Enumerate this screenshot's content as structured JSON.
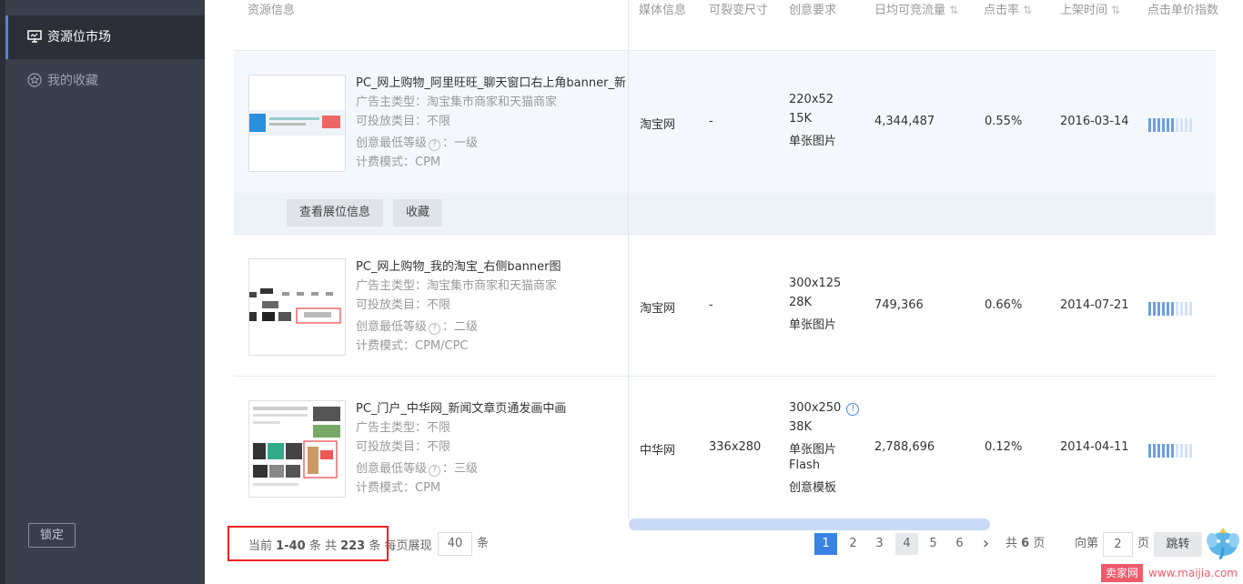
{
  "sidebar": {
    "items": [
      {
        "label": "资源位市场",
        "icon": "monitor-icon"
      },
      {
        "label": "我的收藏",
        "icon": "star-icon"
      }
    ],
    "lock_label": "锁定"
  },
  "table": {
    "headers": {
      "resource": "资源信息",
      "media": "媒体信息",
      "resizable": "可裂变尺寸",
      "creative": "创意要求",
      "traffic": "日均可竞流量",
      "ctr": "点击率",
      "date": "上架时间",
      "cpc_index": "点击单价指数"
    },
    "sort_glyph": "⇅",
    "rows": [
      {
        "title": "PC_网上购物_阿里旺旺_聊天窗口右上角banner_新",
        "advertiser": "广告主类型：淘宝集市商家和天猫商家",
        "category": "可投放类目：不限",
        "level_label": "创意最低等级",
        "level_value": "：一级",
        "billing": "计费模式：CPM",
        "media": "淘宝网",
        "resizable": "-",
        "spec": [
          "220x52",
          "15K",
          "单张图片"
        ],
        "traffic": "4,344,487",
        "ctr": "0.55%",
        "date": "2016-03-14",
        "cpc_index_level": 0.6,
        "actions": {
          "view": "查看展位信息",
          "fav": "收藏"
        }
      },
      {
        "title": "PC_网上购物_我的淘宝_右侧banner图",
        "advertiser": "广告主类型：淘宝集市商家和天猫商家",
        "category": "可投放类目：不限",
        "level_label": "创意最低等级",
        "level_value": "：二级",
        "billing": "计费模式：CPM/CPC",
        "media": "淘宝网",
        "resizable": "-",
        "spec": [
          "300x125",
          "28K",
          "单张图片"
        ],
        "traffic": "749,366",
        "ctr": "0.66%",
        "date": "2014-07-21",
        "cpc_index_level": 0.6
      },
      {
        "title": "PC_门户_中华网_新闻文章页通发画中画",
        "advertiser": "广告主类型：不限",
        "category": "可投放类目：不限",
        "level_label": "创意最低等级",
        "level_value": "：三级",
        "billing": "计费模式：CPM",
        "media": "中华网",
        "resizable": "336x280",
        "spec": [
          "300x250",
          "38K",
          "单张图片",
          "Flash",
          "创意模板"
        ],
        "traffic": "2,788,696",
        "ctr": "0.12%",
        "date": "2014-04-11",
        "cpc_index_level": 0.6
      }
    ]
  },
  "footer": {
    "current_prefix": "当前 ",
    "current_range": "1-40",
    "current_suffix": " 条   共 ",
    "total": "223",
    "total_suffix": " 条",
    "per_page_label": "每页展现",
    "per_page_value": "40",
    "per_page_unit": "条",
    "pages": [
      "1",
      "2",
      "3",
      "4",
      "5",
      "6"
    ],
    "current_page": "1",
    "next_glyph": "›",
    "total_pages_prefix": "共",
    "total_pages": "6",
    "total_pages_suffix": "页",
    "jump_prefix": "向第",
    "jump_value": "2",
    "jump_suffix": "页",
    "jump_button": "跳转"
  },
  "watermark": {
    "tag": "卖家网",
    "url": "www.maijia.com"
  },
  "colors": {
    "accent": "#3b82e5",
    "sidebar": "#3b3f4c",
    "highlight_box": "#ee2222"
  }
}
